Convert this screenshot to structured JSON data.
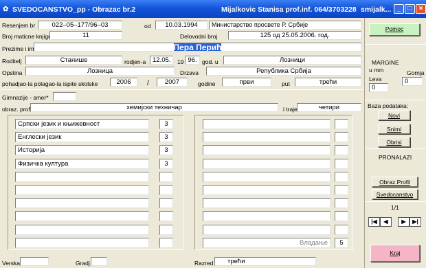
{
  "window": {
    "title": "SVEDOCANSTVO_pp  -  Obrazac br.2",
    "user": "Mijalkovic Stanisa  prof.inf.  064/3703228",
    "app": "smijalk...",
    "controls": [
      "_",
      "□",
      "×"
    ]
  },
  "header": {
    "resenje_label": "Resenjem br",
    "resenje_value": "022–05–177/96–03",
    "od_label": "od",
    "datum": "10.03.1994",
    "ministarstvo": "Министарство просвете Р. Србије",
    "maticna_label": "Broj maticne knjige",
    "maticna_value": "11",
    "delovodni_label": "Delovodni broj",
    "delovodni_value": "125 од 25.05.2006. год.",
    "ime_label": "Prezime i ime",
    "ime_value": "Пера Перић",
    "roditelj_label": "Roditelj",
    "roditelj_value": "Станише",
    "rodjen_label": "rodjen-a",
    "rodjen_value": "12.05.",
    "god_prefix": "19",
    "god_value": "96.",
    "god_u_label": "god. u",
    "mesto_value": "Лозници",
    "opstina_label": "Opstina",
    "opstina_value": "Лозница",
    "drzava_label": "Drzava",
    "drzava_value": "Република Србија",
    "skolska_label": "pohadjao-la polagao-la ispite skolske",
    "skolska_od": "2006",
    "slash": "/",
    "skolska_do": "2007",
    "godine_label": "godine",
    "razred_value": "први",
    "put_label": "put",
    "ocena_value": "трећи"
  },
  "smer": {
    "label": "Gimnazije - smer*",
    "profil_label": "obraz. profil",
    "profil_value": "хемијски техничар",
    "traje_label": "i traje",
    "traje_value": "четири"
  },
  "subjects_left": [
    {
      "name": "Српски језик и књижевност",
      "grade": "3"
    },
    {
      "name": "Енглески језик",
      "grade": "3"
    },
    {
      "name": "Историја",
      "grade": "3"
    },
    {
      "name": "Физичка култура",
      "grade": "3"
    },
    {
      "name": "",
      "grade": ""
    },
    {
      "name": "",
      "grade": ""
    },
    {
      "name": "",
      "grade": ""
    },
    {
      "name": "",
      "grade": ""
    },
    {
      "name": "",
      "grade": ""
    },
    {
      "name": "",
      "grade": ""
    }
  ],
  "subjects_right": [
    {
      "name": "",
      "grade": ""
    },
    {
      "name": "",
      "grade": ""
    },
    {
      "name": "",
      "grade": ""
    },
    {
      "name": "",
      "grade": ""
    },
    {
      "name": "",
      "grade": ""
    },
    {
      "name": "",
      "grade": ""
    },
    {
      "name": "",
      "grade": ""
    },
    {
      "name": "",
      "grade": ""
    },
    {
      "name": "",
      "grade": ""
    },
    {
      "name": "Владање",
      "grade": "5"
    }
  ],
  "footer": {
    "verska_label": "Verska",
    "verska_value": "",
    "grad_label": "Gradj",
    "grad_value": "",
    "razred_label": "Razred",
    "razred_value": "трећи"
  },
  "sidebar": {
    "pomoc": "Pomoc",
    "margine_title": "MARGINE",
    "u_mm": "u mm",
    "gornja_label": "Gornja",
    "gornja_value": "0",
    "leva_label": "Leva",
    "leva_value": "0",
    "baza_label": "Baza podataka:",
    "novi": "Novi",
    "snimi": "Snimi",
    "obrisi": "Obrisi",
    "pronalazi": "PRONALAZI",
    "obraz_profil": "Obraz.Profil",
    "svedocanstvo": "Svedocanstvo",
    "page": "1/1",
    "nav": [
      "|◀",
      "◀",
      "▶",
      "▶|"
    ],
    "kraj": "Kraj"
  },
  "colors": {
    "title_bar": "#0a45c6",
    "name_highlight": "#2a63d6",
    "pomoc_button": "#c8f2c0",
    "kraj_button": "#f6b5c6"
  }
}
